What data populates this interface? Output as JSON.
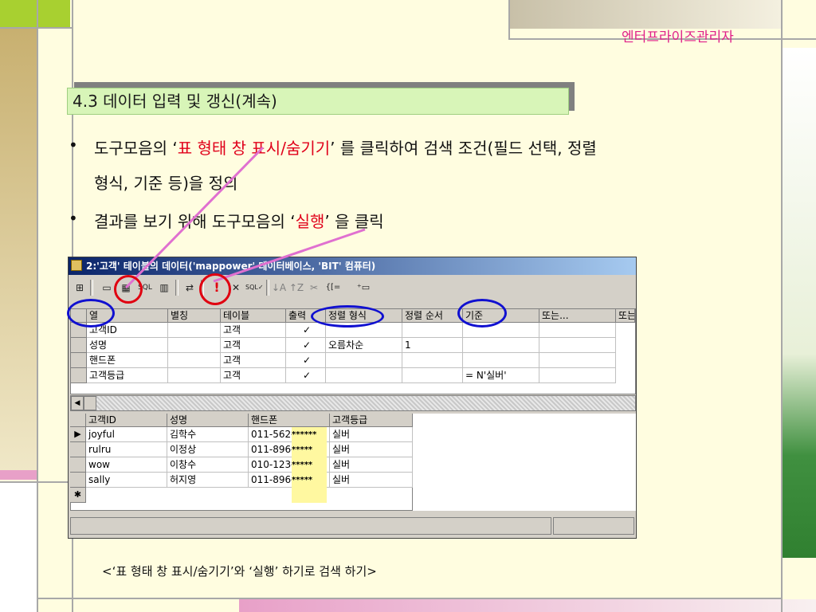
{
  "header": {
    "brand": "엔터프라이즈관리자"
  },
  "slide": {
    "title": "4.3 데이터 입력 및 갱신(계속)",
    "bullets": [
      {
        "prefix": "도구모음의 ‘",
        "highlight": "표 형태 창 표시/숨기기",
        "suffix": "’ 를 클릭하여 검색 조건(필드 선택, 정렬",
        "cont": "형식, 기준 등)을 정의"
      },
      {
        "prefix": "결과를 보기 위해 도구모음의 ‘",
        "highlight": "실행",
        "suffix": "’ 을 클릭"
      }
    ],
    "caption": "<‘표 형태 창 표시/숨기기’와 ‘실행’ 하기로 검색 하기>"
  },
  "window": {
    "title": "2:'고객' 테이블의 데이터('mappower' 데이터베이스, 'BIT' 컴퓨터)",
    "toolbar": [
      "⊞",
      "▭",
      "▦",
      "SQL",
      "▥",
      "⇄",
      "!",
      "✕",
      "SQL✓",
      "↓A",
      "↑Z",
      "✂",
      "{[=",
      "⁺▭"
    ],
    "criteria": {
      "columns": [
        "열",
        "별칭",
        "테이블",
        "출력",
        "정렬 형식",
        "정렬 순서",
        "기준",
        "또는...",
        "또는"
      ],
      "rows": [
        [
          "고객ID",
          "",
          "고객",
          "✓",
          "",
          "",
          "",
          "",
          ""
        ],
        [
          "성명",
          "",
          "고객",
          "✓",
          "오름차순",
          "1",
          "",
          "",
          ""
        ],
        [
          "핸드폰",
          "",
          "고객",
          "✓",
          "",
          "",
          "",
          "",
          ""
        ],
        [
          "고객등급",
          "",
          "고객",
          "✓",
          "",
          "",
          "= N'실버'",
          "",
          ""
        ]
      ]
    },
    "results": {
      "columns": [
        "고객ID",
        "성명",
        "핸드폰",
        "고객등급"
      ],
      "rows": [
        [
          "joyful",
          "김학수",
          "011-562-",
          "******",
          "실버"
        ],
        [
          "rulru",
          "이정상",
          "011-896-",
          "*****",
          "실버"
        ],
        [
          "wow",
          "이창수",
          "010-123-",
          "*****",
          "실버"
        ],
        [
          "sally",
          "허지영",
          "011-896-",
          "*****",
          "실버"
        ]
      ],
      "new_row_marker": "✱",
      "current_row_marker": "▶"
    }
  },
  "colors": {
    "accent_red": "#e00010",
    "oval_blue": "#1010d0",
    "title_green": "#d8f5b8",
    "brand_pink": "#e0208a"
  }
}
